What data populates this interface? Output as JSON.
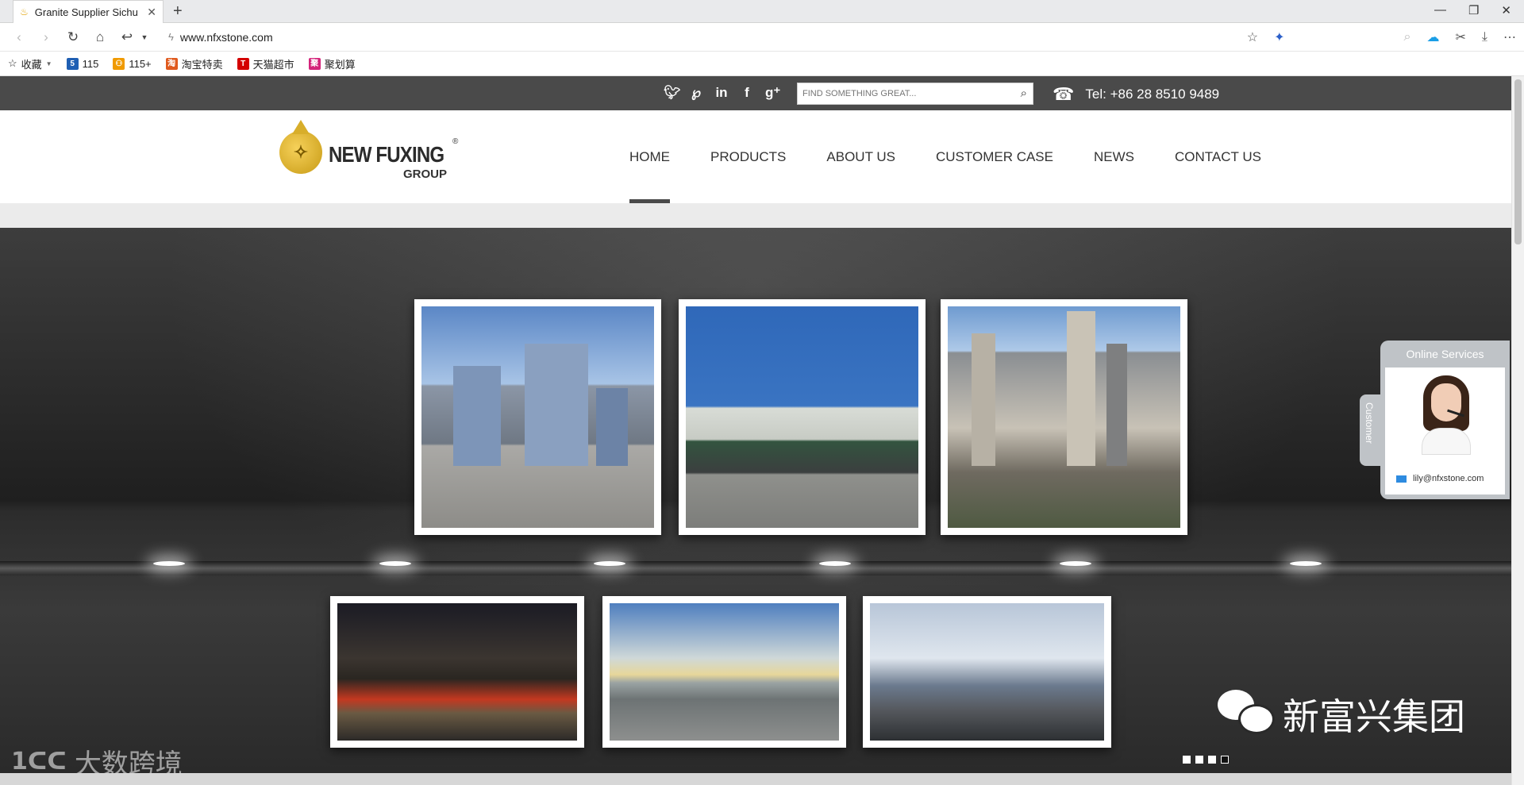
{
  "browser": {
    "tab_title": "Granite Supplier Sichu",
    "tab_icon": "flame-favicon",
    "url": "www.nfxstone.com",
    "bookmarks": [
      {
        "label": "收藏",
        "color": "#333333"
      },
      {
        "label": "115",
        "color": "#1f5fb3"
      },
      {
        "label": "115+",
        "color": "#f09a00"
      },
      {
        "label": "淘宝特卖",
        "color": "#e05a1e"
      },
      {
        "label": "天猫超市",
        "color": "#d40000"
      },
      {
        "label": "聚划算",
        "color": "#d4237a"
      }
    ]
  },
  "site": {
    "search_placeholder": "FIND SOMETHING GREAT...",
    "tel": "Tel: +86 28 8510 9489",
    "social_icons": [
      "twitter-icon",
      "pinterest-icon",
      "linkedin-icon",
      "facebook-icon",
      "google-plus-icon"
    ],
    "logo": {
      "name": "NEW FUXING",
      "reg": "®",
      "group": "GROUP"
    },
    "nav": [
      {
        "label": "HOME",
        "active": true
      },
      {
        "label": "PRODUCTS",
        "active": false
      },
      {
        "label": "ABOUT US",
        "active": false
      },
      {
        "label": "CUSTOMER CASE",
        "active": false
      },
      {
        "label": "NEWS",
        "active": false
      },
      {
        "label": "CONTACT US",
        "active": false
      }
    ],
    "slider": {
      "total": 4,
      "active_index": 3
    },
    "online_services": {
      "title": "Online Services",
      "tab_label": "Customer",
      "email": "lily@nfxstone.com"
    },
    "wechat_text": "新富兴集团",
    "watermark": "大数跨境"
  }
}
